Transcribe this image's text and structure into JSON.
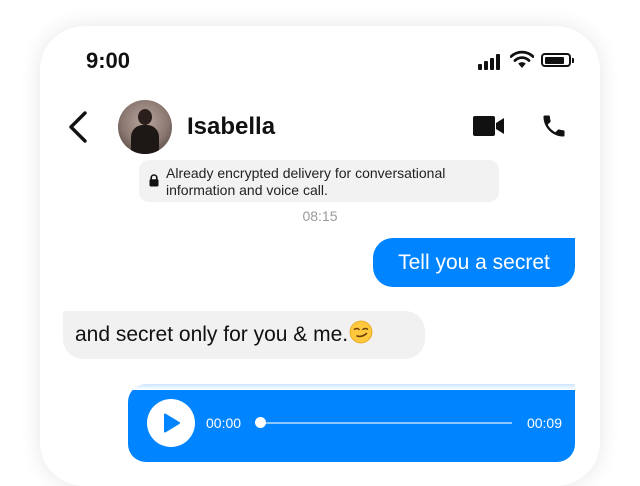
{
  "status_bar": {
    "time": "9:00",
    "battery_level": 0.85
  },
  "header": {
    "contact_name": "Isabella",
    "icons": [
      "back-icon",
      "avatar",
      "video-call-icon",
      "phone-call-icon"
    ]
  },
  "encryption_notice": {
    "line1": "Already encrypted delivery for conversational",
    "line2": "information and voice call."
  },
  "timestamp": "08:15",
  "messages": [
    {
      "direction": "outgoing",
      "text": "Tell you a secret"
    },
    {
      "direction": "incoming",
      "text": "and secret only for you & me.",
      "emoji": "smirk"
    },
    {
      "direction": "outgoing",
      "type": "voice",
      "position": "00:00",
      "duration": "00:09",
      "progress": 0
    }
  ],
  "colors": {
    "accent": "#0084ff",
    "incoming_bubble": "#f1f1f1",
    "notice_bg": "#f2f2f2"
  }
}
